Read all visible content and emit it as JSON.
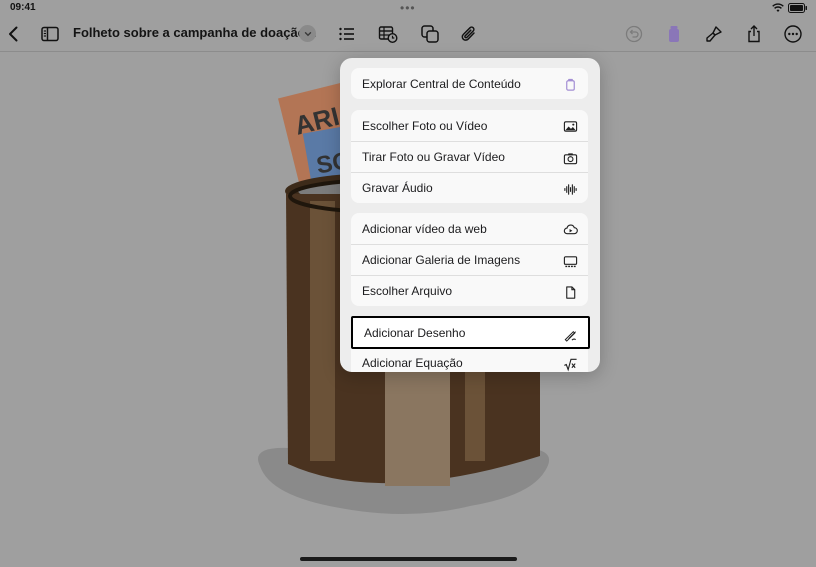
{
  "status": {
    "time": "09:41",
    "dots": "•••"
  },
  "toolbar": {
    "title": "Folheto sobre a campanha de doação...",
    "icons": [
      "back-icon",
      "sidebar-icon",
      "chevron-down-icon",
      "list-icon",
      "table-clock-icon",
      "shapes-icon",
      "paperclip-icon",
      "undo-icon",
      "trash-icon",
      "brush-icon",
      "share-icon",
      "more-icon"
    ]
  },
  "menu": {
    "groups": [
      {
        "items": [
          {
            "label": "Explorar Central de Conteúdo",
            "icon": "trash-can-purple-icon"
          }
        ]
      },
      {
        "items": [
          {
            "label": "Escolher Foto ou Vídeo",
            "icon": "photo-icon"
          },
          {
            "label": "Tirar Foto ou Gravar Vídeo",
            "icon": "camera-icon"
          },
          {
            "label": "Gravar Áudio",
            "icon": "waveform-icon"
          }
        ]
      },
      {
        "items": [
          {
            "label": "Adicionar vídeo da web",
            "icon": "cloud-play-icon"
          },
          {
            "label": "Adicionar Galeria de Imagens",
            "icon": "gallery-icon"
          },
          {
            "label": "Escolher Arquivo",
            "icon": "file-icon"
          }
        ]
      },
      {
        "items": [
          {
            "label": "Adicionar Desenho",
            "icon": "drawing-icon"
          },
          {
            "label": "Adicionar Equação",
            "icon": "sqrt-icon"
          }
        ]
      }
    ]
  },
  "canvas": {
    "sign_text_1": "ARI",
    "sign_text_2": "SO"
  },
  "colors": {
    "accent_purple": "#a48fd4",
    "overlay_bg": "#9f9f9f"
  }
}
